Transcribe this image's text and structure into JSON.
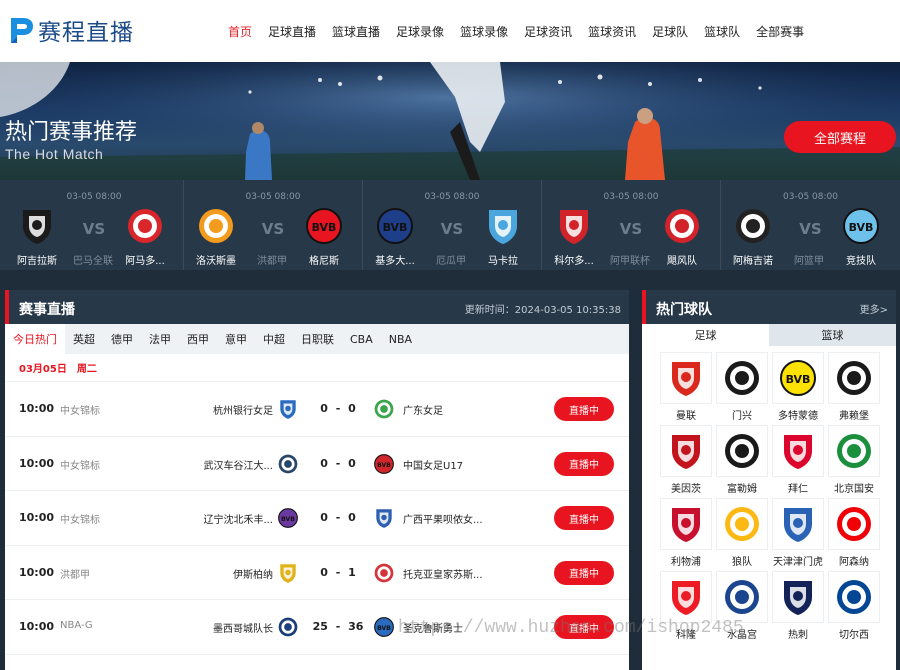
{
  "logo": {
    "text": "赛程直播"
  },
  "nav": [
    {
      "label": "首页",
      "active": true
    },
    {
      "label": "足球直播"
    },
    {
      "label": "篮球直播"
    },
    {
      "label": "足球录像"
    },
    {
      "label": "篮球录像"
    },
    {
      "label": "足球资讯"
    },
    {
      "label": "篮球资讯"
    },
    {
      "label": "足球队"
    },
    {
      "label": "篮球队"
    },
    {
      "label": "全部赛事"
    }
  ],
  "hero": {
    "title": "热门赛事推荐",
    "subtitle": "The Hot Match",
    "button": "全部赛程"
  },
  "hot_matches": [
    {
      "time": "03-05 08:00",
      "home": "阿吉拉斯",
      "league": "巴马全联",
      "away": "阿马多...",
      "vs": "VS",
      "home_color": "#1b1b1b",
      "away_color": "#d8262b"
    },
    {
      "time": "03-05 08:00",
      "home": "洛沃斯墨",
      "league": "洪都甲",
      "away": "格尼斯",
      "vs": "VS",
      "home_color": "#f29b1d",
      "away_color": "#e8141f"
    },
    {
      "time": "03-05 08:00",
      "home": "基多大...",
      "league": "厄瓜甲",
      "away": "马卡拉",
      "vs": "VS",
      "home_color": "#1e3e8a",
      "away_color": "#4aa6dc"
    },
    {
      "time": "03-05 08:00",
      "home": "科尔多...",
      "league": "阿甲联杯",
      "away": "飓风队",
      "vs": "VS",
      "home_color": "#d2232a",
      "away_color": "#d2232a"
    },
    {
      "time": "03-05 08:00",
      "home": "阿梅吉诺",
      "league": "阿篮甲",
      "away": "竞技队",
      "vs": "VS",
      "home_color": "#222222",
      "away_color": "#6ec1ea"
    }
  ],
  "live": {
    "title": "赛事直播",
    "update_label": "更新时间：",
    "update_time": "2024-03-05 10:35:38",
    "tabs": [
      {
        "label": "今日热门",
        "active": true
      },
      {
        "label": "英超"
      },
      {
        "label": "德甲"
      },
      {
        "label": "法甲"
      },
      {
        "label": "西甲"
      },
      {
        "label": "意甲"
      },
      {
        "label": "中超"
      },
      {
        "label": "日职联"
      },
      {
        "label": "CBA"
      },
      {
        "label": "NBA"
      }
    ],
    "date": "03月05日",
    "weekday": "周二",
    "matches": [
      {
        "time": "10:00",
        "league": "中女锦标",
        "home": "杭州银行女足",
        "score": "0 - 0",
        "away": "广东女足",
        "button": "直播中",
        "home_color": "#2a6bbf",
        "away_color": "#3aa54a"
      },
      {
        "time": "10:00",
        "league": "中女锦标",
        "home": "武汉车谷江大...",
        "score": "0 - 0",
        "away": "中国女足U17",
        "button": "直播中",
        "home_color": "#27486b",
        "away_color": "#d1262b"
      },
      {
        "time": "10:00",
        "league": "中女锦标",
        "home": "辽宁沈北禾丰...",
        "score": "0 - 0",
        "away": "广西平果呗侬女...",
        "button": "直播中",
        "home_color": "#6b3aa0",
        "away_color": "#2f5fb3"
      },
      {
        "time": "10:00",
        "league": "洪都甲",
        "home": "伊斯柏纳",
        "score": "0 - 1",
        "away": "托克亚皇家苏斯...",
        "button": "直播中",
        "home_color": "#e2b21a",
        "away_color": "#d4343a"
      },
      {
        "time": "10:00",
        "league": "NBA-G",
        "home": "墨西哥城队长",
        "score": "25 - 36",
        "away": "圣克鲁斯勇士",
        "button": "直播中",
        "home_color": "#1b3f7a",
        "away_color": "#2a6bbf"
      }
    ]
  },
  "teams": {
    "title": "热门球队",
    "more": "更多>",
    "tabs": [
      {
        "label": "足球",
        "active": true
      },
      {
        "label": "篮球"
      }
    ],
    "list": [
      {
        "name": "曼联",
        "icon": "man-utd-crest",
        "color": "#da291c"
      },
      {
        "name": "门兴",
        "icon": "gladbach-crest",
        "color": "#1a1a1a"
      },
      {
        "name": "多特蒙德",
        "icon": "dortmund-crest",
        "color": "#fde100"
      },
      {
        "name": "弗赖堡",
        "icon": "freiburg-crest",
        "color": "#1a1a1a"
      },
      {
        "name": "美因茨",
        "icon": "mainz-crest",
        "color": "#c3141e"
      },
      {
        "name": "富勒姆",
        "icon": "fulham-crest",
        "color": "#1a1a1a"
      },
      {
        "name": "拜仁",
        "icon": "bayern-crest",
        "color": "#dc052d"
      },
      {
        "name": "北京国安",
        "icon": "guoan-crest",
        "color": "#1c8f3d"
      },
      {
        "name": "利物浦",
        "icon": "liverpool-crest",
        "color": "#c8102e"
      },
      {
        "name": "狼队",
        "icon": "wolves-crest",
        "color": "#fdb913"
      },
      {
        "name": "天津津门虎",
        "icon": "tianjin-crest",
        "color": "#2a62b5"
      },
      {
        "name": "阿森纳",
        "icon": "arsenal-crest",
        "color": "#ef0107"
      },
      {
        "name": "科隆",
        "icon": "koln-crest",
        "color": "#ed1c24"
      },
      {
        "name": "水晶宫",
        "icon": "palace-crest",
        "color": "#1b458f"
      },
      {
        "name": "热刺",
        "icon": "spurs-crest",
        "color": "#132257"
      },
      {
        "name": "切尔西",
        "icon": "chelsea-crest",
        "color": "#034694"
      }
    ]
  },
  "watermark": "https://www.huzhan.com/ishop2485"
}
